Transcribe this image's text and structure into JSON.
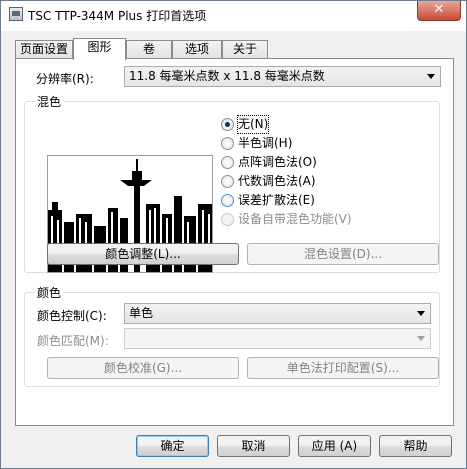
{
  "window": {
    "title": "TSC TTP-344M Plus 打印首选项",
    "close_glyph": "✕"
  },
  "tabs": [
    "页面设置",
    "图形",
    "卷",
    "选项",
    "关于"
  ],
  "resolution": {
    "label": "分辨率(R):",
    "value": "11.8 每毫米点数 x 11.8 每毫米点数"
  },
  "dithering": {
    "title": "混色",
    "options": [
      {
        "label": "无(N)",
        "checked": true,
        "enabled": true
      },
      {
        "label": "半色调(H)",
        "checked": false,
        "enabled": true
      },
      {
        "label": "点阵调色法(O)",
        "checked": false,
        "enabled": true
      },
      {
        "label": "代数调色法(A)",
        "checked": false,
        "enabled": true
      },
      {
        "label": "误差扩散法(E)",
        "checked": false,
        "enabled": true
      },
      {
        "label": "设备自带混色功能(V)",
        "checked": false,
        "enabled": false
      }
    ],
    "adjust_button": "颜色调整(L)...",
    "settings_button": "混色设置(D)..."
  },
  "color": {
    "title": "颜色",
    "control_label": "颜色控制(C):",
    "control_value": "单色",
    "match_label": "颜色匹配(M):",
    "match_value": "",
    "calibrate_button": "颜色校准(G)...",
    "mono_print_button": "单色法打印配置(S)..."
  },
  "footer": {
    "ok": "确定",
    "cancel": "取消",
    "apply": "应用 (A)",
    "help": "帮助"
  },
  "colors": {
    "accent": "#3c7fb1",
    "close": "#c74b36"
  }
}
